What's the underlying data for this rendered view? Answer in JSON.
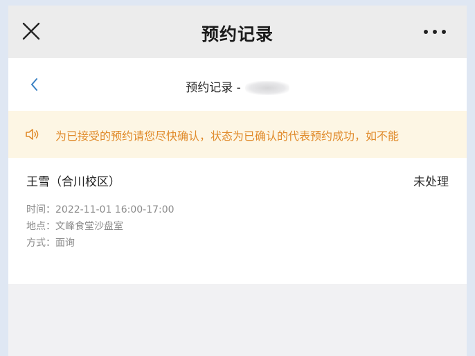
{
  "titlebar": {
    "title": "预约记录"
  },
  "subnav": {
    "title": "预约记录 -"
  },
  "notice": {
    "text": "为已接受的预约请您尽快确认，状态为已确认的代表预约成功，如不能"
  },
  "records": [
    {
      "name": "王雪（合川校区）",
      "status": "未处理",
      "time": "时间：2022-11-01 16:00-17:00",
      "location": "地点：文峰食堂沙盘室",
      "method": "方式：面询"
    }
  ],
  "colors": {
    "notice_bg": "#fdf6e4",
    "notice_text": "#e08a2a",
    "back_arrow": "#3b82c4"
  },
  "icons": {
    "close": "close-icon",
    "more": "more-dots-icon",
    "back": "chevron-left-icon",
    "notice": "speaker-icon"
  }
}
